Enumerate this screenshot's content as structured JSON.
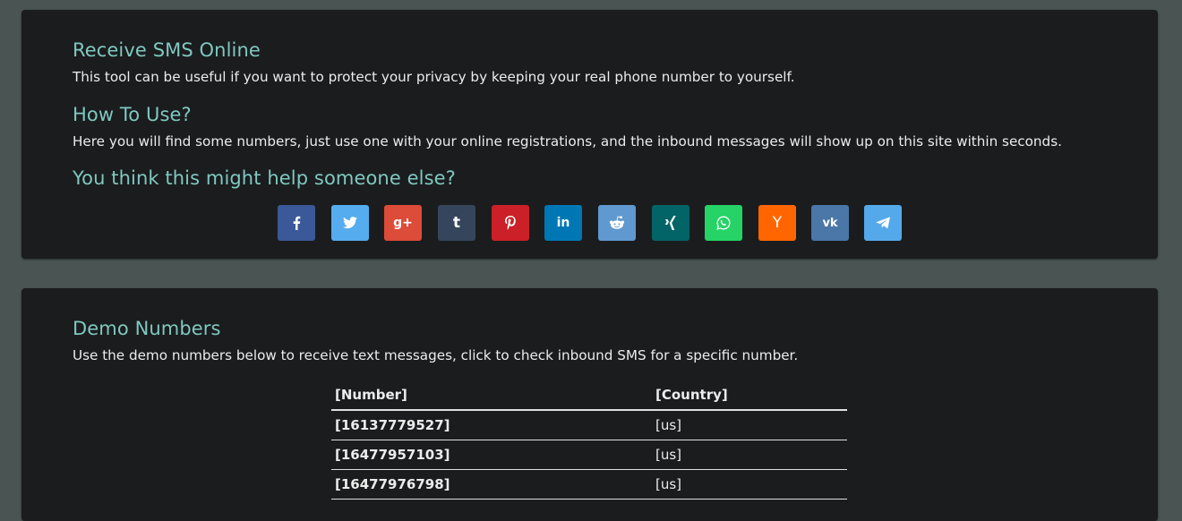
{
  "intro": {
    "title": "Receive SMS Online",
    "description": "This tool can be useful if you want to protect your privacy by keeping your real phone number to yourself.",
    "how_title": "How To Use?",
    "how_text": "Here you will find some numbers, just use one with your online registrations, and the inbound messages will show up on this site within seconds.",
    "share_title": "You think this might help someone else?"
  },
  "share_buttons": [
    {
      "name": "facebook",
      "glyph": "f",
      "color": "#3b5998",
      "icon": "facebook-icon"
    },
    {
      "name": "twitter",
      "glyph": "",
      "color": "#55acee",
      "icon": "twitter-icon"
    },
    {
      "name": "google-plus",
      "glyph": "g+",
      "color": "#dd4b39",
      "icon": "google-plus-icon"
    },
    {
      "name": "tumblr",
      "glyph": "t",
      "color": "#35465c",
      "icon": "tumblr-icon"
    },
    {
      "name": "pinterest",
      "glyph": "P",
      "color": "#cb2027",
      "icon": "pinterest-icon"
    },
    {
      "name": "linkedin",
      "glyph": "in",
      "color": "#0077b5",
      "icon": "linkedin-icon"
    },
    {
      "name": "reddit",
      "glyph": "",
      "color": "#5f99cf",
      "icon": "reddit-icon"
    },
    {
      "name": "xing",
      "glyph": "",
      "color": "#026466",
      "icon": "xing-icon"
    },
    {
      "name": "whatsapp",
      "glyph": "",
      "color": "#25d366",
      "icon": "whatsapp-icon"
    },
    {
      "name": "hacker-news",
      "glyph": "Y",
      "color": "#ff6600",
      "icon": "hacker-news-icon"
    },
    {
      "name": "vk",
      "glyph": "vk",
      "color": "#4a76a8",
      "icon": "vk-icon"
    },
    {
      "name": "telegram",
      "glyph": "",
      "color": "#54a9eb",
      "icon": "telegram-icon"
    }
  ],
  "demo": {
    "title": "Demo Numbers",
    "description": "Use the demo numbers below to receive text messages, click to check inbound SMS for a specific number.",
    "table": {
      "headers": [
        "[Number]",
        "[Country]"
      ],
      "rows": [
        [
          "[16137779527]",
          "[us]"
        ],
        [
          "[16477957103]",
          "[us]"
        ],
        [
          "[16477976798]",
          "[us]"
        ]
      ]
    }
  },
  "colors": {
    "page_bg": "#4a5553",
    "panel_bg": "#1b1c1e",
    "heading": "#7fc8c0",
    "text": "#ececec"
  }
}
